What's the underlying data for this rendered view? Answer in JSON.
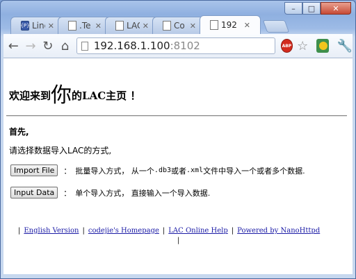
{
  "window": {
    "controls": {
      "minimize": "–",
      "maximize": "□",
      "close": "✕"
    }
  },
  "tabs": [
    {
      "label": "Ling",
      "icon": "{P}",
      "close": "✕"
    },
    {
      "label": ".Te",
      "icon": "",
      "close": "✕"
    },
    {
      "label": "LAC",
      "icon": "",
      "close": "✕"
    },
    {
      "label": "Co",
      "icon": "",
      "close": "✕"
    },
    {
      "label": "192",
      "icon": "",
      "close": "✕",
      "active": true
    }
  ],
  "toolbar": {
    "back": "←",
    "forward": "→",
    "reload": "↻",
    "home": "⌂",
    "url_host": "192.168.1.100",
    "url_port": ":8102",
    "abp_label": "ABP",
    "star": "☆",
    "wrench": "🔧"
  },
  "page": {
    "welcome_before": "欢迎来到",
    "welcome_big": "你",
    "welcome_after": "的LAC主页 ！",
    "first": "首先,",
    "choose": "请选择数据导入LAC的方式,",
    "import_file_button": "Import File",
    "import_file_sep": "：",
    "import_file_desc_1": "批量导入方式， 从一个",
    "import_file_desc_db3": ".db3",
    "import_file_desc_2": "或者",
    "import_file_desc_xml": ".xml",
    "import_file_desc_3": "文件中导入一个或者多个数据.",
    "input_data_button": "Input Data",
    "input_data_sep": "：",
    "input_data_desc": "单个导入方式， 直接输入一个导入数据."
  },
  "footer": {
    "links": [
      "English Version",
      "codejie's Homepage",
      "LAC Online Help",
      "Powered by NanoHttpd"
    ],
    "separator": "|"
  },
  "colors": {
    "link": "#1a1aa6",
    "abp_red": "#d32b1e"
  }
}
